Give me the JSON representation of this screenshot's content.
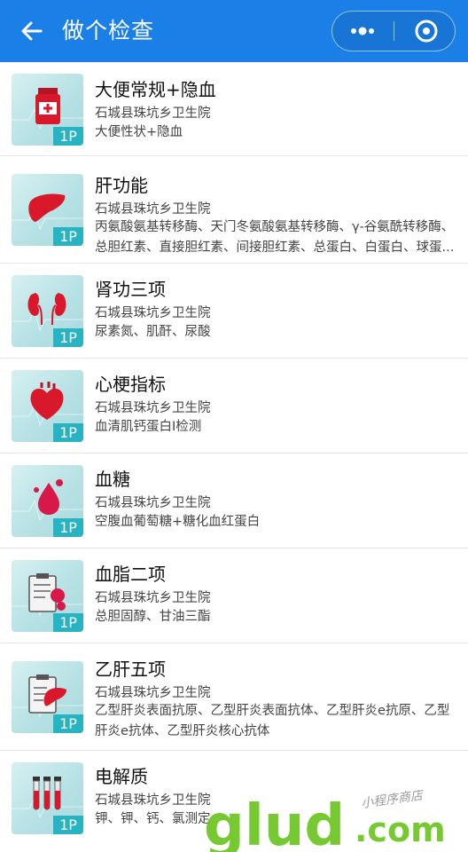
{
  "header": {
    "title": "做个检查",
    "back_icon": "back-arrow-icon",
    "more_icon": "more-dots-icon",
    "close_icon": "target-close-icon"
  },
  "colors": {
    "header": "#1b7fe8",
    "badge": "#27b3c1",
    "organ": "#d9182b",
    "watermark": "#6bc51f"
  },
  "items": [
    {
      "name": "大便常规+隐血",
      "hospital": "石城县珠坑乡卫生院",
      "desc": "大便性状+隐血",
      "badge": "1P",
      "icon": "medicine-bottle-icon"
    },
    {
      "name": "肝功能",
      "hospital": "石城县珠坑乡卫生院",
      "desc": "丙氨酸氨基转移酶、天门冬氨酸氨基转移酶、γ-谷氨酰转移酶、总胆红素、直接胆红素、间接胆红素、总蛋白、白蛋白、球蛋...",
      "badge": "1P",
      "icon": "liver-icon"
    },
    {
      "name": "肾功三项",
      "hospital": "石城县珠坑乡卫生院",
      "desc": "尿素氮、肌酐、尿酸",
      "badge": "1P",
      "icon": "kidneys-icon"
    },
    {
      "name": "心梗指标",
      "hospital": "石城县珠坑乡卫生院",
      "desc": "血清肌钙蛋白I检测",
      "badge": "1P",
      "icon": "heart-icon"
    },
    {
      "name": "血糖",
      "hospital": "石城县珠坑乡卫生院",
      "desc": "空腹血葡萄糖+糖化血红蛋白",
      "badge": "1P",
      "icon": "blood-drop-icon"
    },
    {
      "name": "血脂二项",
      "hospital": "石城县珠坑乡卫生院",
      "desc": "总胆固醇、甘油三酯",
      "badge": "1P",
      "icon": "clipboard-blood-icon"
    },
    {
      "name": "乙肝五项",
      "hospital": "石城县珠坑乡卫生院",
      "desc": "乙型肝炎表面抗原、乙型肝炎表面抗体、乙型肝炎e抗原、乙型肝炎e抗体、乙型肝炎核心抗体",
      "badge": "1P",
      "icon": "clipboard-liver-icon"
    },
    {
      "name": "电解质",
      "hospital": "石城县珠坑乡卫生院",
      "desc": "钾、钾、钙、氯测定",
      "badge": "1P",
      "icon": "test-tubes-icon"
    }
  ],
  "watermark": {
    "brand": "glud",
    "domain": ".com",
    "tagline": "小程序商店"
  }
}
